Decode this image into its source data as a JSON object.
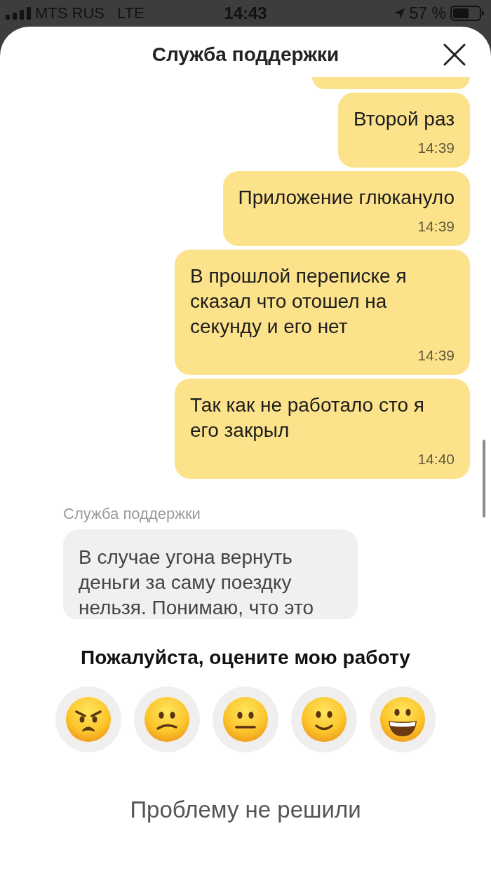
{
  "status_bar": {
    "carrier": "MTS RUS",
    "network": "LTE",
    "time": "14:43",
    "battery": "57 %"
  },
  "header": {
    "title": "Служба поддержки"
  },
  "chat": {
    "hidden_message_above": true,
    "messages": [
      {
        "kind": "outgoing",
        "text": "Второй раз",
        "time": "14:39"
      },
      {
        "kind": "outgoing",
        "text": "Приложение глюкануло",
        "time": "14:39"
      },
      {
        "kind": "outgoing",
        "text": "В прошлой переписке я сказал что отошел на секунду и его нет",
        "time": "14:39"
      },
      {
        "kind": "outgoing",
        "text": "Так как не работало сто я его закрыл",
        "time": "14:40"
      },
      {
        "kind": "incoming",
        "sender": "Служба поддержки",
        "text": "В случае угона вернуть деньги за саму поездку нельзя. Понимаю, что это"
      }
    ]
  },
  "rating": {
    "title": "Пожалуйста, оцените мою работу",
    "options": [
      {
        "kind": "angry"
      },
      {
        "kind": "frowning"
      },
      {
        "kind": "neutral"
      },
      {
        "kind": "smiling"
      },
      {
        "kind": "grinning"
      }
    ]
  },
  "footer": {
    "link": "Проблему не решили"
  }
}
